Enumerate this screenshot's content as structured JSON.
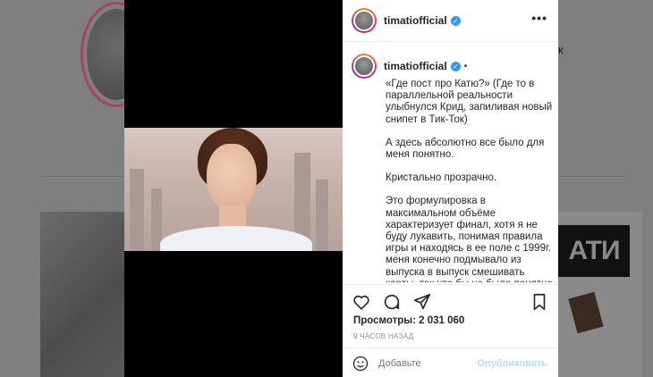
{
  "post": {
    "username": "timatiofficial",
    "verified": true,
    "caption_username": "timatiofficial",
    "caption_paragraphs": [
      "«Где пост про Катю?» (Где то в параллельной реальности улыбнулся Крид, запиливая новый снипет в Тик-Ток)",
      "А здесь абсолютно все было для меня понятно.",
      "Кристально прозрачно.",
      "Это формулировка в максимальном объёме характеризует финал, хотя я не буду лукавить, понимая правила игры и находясь в ее поле с 1999г. меня конечно подмывало из выпуска в выпуск смешивать карты, так что бы не было понятно что я думаю, даже девочкам участницам и"
    ],
    "views": "Просмотры: 2 031 060",
    "time": "9 ЧАСОВ НАЗАД",
    "comment_placeholder": "Добавьте",
    "publish_label": "Опубликовать"
  },
  "background": {
    "partial_letter": "к",
    "logo_text": "АТИ"
  },
  "icons": {
    "like": "heart-icon",
    "comment": "comment-icon",
    "share": "share-icon",
    "save": "bookmark-icon",
    "emoji": "smile-icon",
    "more": "more-icon"
  },
  "colors": {
    "verified": "#3897f0",
    "publish_disabled": "#b2dffc"
  }
}
